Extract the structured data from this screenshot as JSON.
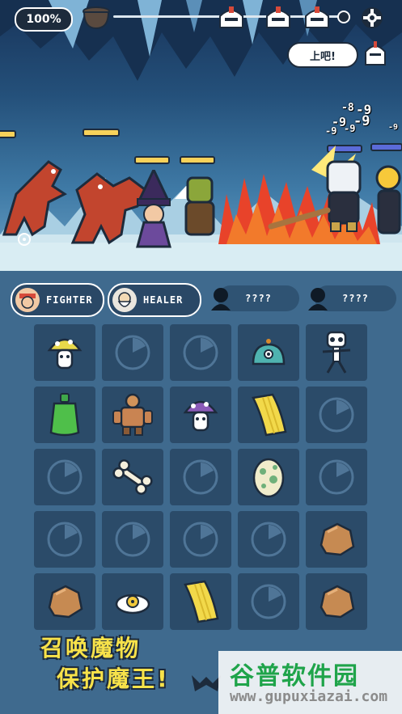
{
  "hud": {
    "health_percent_label": "100%",
    "stage_progress_icons": [
      "cauldron-icon",
      "knight-helmet-icon",
      "knight-helmet-icon",
      "knight-helmet-icon",
      "end-node-icon"
    ],
    "settings_icon": "gear-icon"
  },
  "speech": {
    "text": "上吧!"
  },
  "battle": {
    "damage_numbers": [
      "-8",
      "-9",
      "-9",
      "-9",
      "-9",
      "-9",
      "-9"
    ],
    "ally_hp_color": "#f7d25a",
    "enemy_hp_color": "#5b6bd9"
  },
  "tabs": [
    {
      "label": "FIGHTER",
      "locked": false
    },
    {
      "label": "HEALER",
      "locked": false
    },
    {
      "label": "????",
      "locked": true
    },
    {
      "label": "????",
      "locked": true
    }
  ],
  "grid": {
    "rows": [
      [
        "mushroom-yellow",
        "timer",
        "timer",
        "slime-eye",
        "skeleton"
      ],
      [
        "green-potion",
        "golem",
        "mushroom-purple",
        "yellow-cloth",
        "timer"
      ],
      [
        "timer",
        "bone",
        "timer",
        "spotted-egg",
        "timer"
      ],
      [
        "timer",
        "timer",
        "timer",
        "timer",
        "rock"
      ],
      [
        "rock",
        "fried-egg",
        "yellow-cloth",
        "timer",
        "rock"
      ]
    ]
  },
  "slogan": {
    "line1": "召唤魔物",
    "line2": "保护魔王!"
  },
  "watermark": {
    "title": "谷普软件园",
    "url": "www.gupuxiazai.com"
  },
  "colors": {
    "panel": "#3f6a8e",
    "cell": "#2b4b69",
    "slogan": "#f7e24a",
    "watermark_green": "#1fa44a"
  }
}
